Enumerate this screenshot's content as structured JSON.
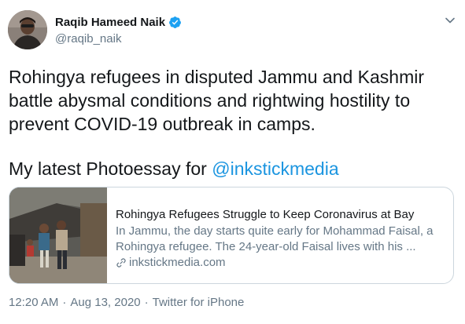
{
  "author": {
    "display_name": "Raqib Hameed Naik",
    "handle": "@raqib_naik",
    "verified": true
  },
  "tweet": {
    "body": "Rohingya refugees in disputed Jammu and Kashmir\nbattle abysmal conditions and rightwing hostility to\nprevent COVID-19 outbreak in camps.",
    "closing_text": "My latest Photoessay for ",
    "mention": "@inkstickmedia"
  },
  "card": {
    "title": "Rohingya Refugees Struggle to Keep Coronavirus at Bay",
    "description_line1": "In Jammu, the day starts quite early for Mohammad Faisal, a",
    "description_line2": "Rohingya refugee. The 24-year-old Faisal lives with his ...",
    "domain": "inkstickmedia.com"
  },
  "meta": {
    "time": "12:20 AM",
    "separator1": "·",
    "date": "Aug 13, 2020",
    "separator2": "·",
    "source": "Twitter for iPhone"
  },
  "icons": {
    "verified": "verified-badge-icon",
    "caret": "chevron-down-icon",
    "link": "link-icon"
  },
  "colors": {
    "link_blue": "#1b95e0",
    "secondary_text": "#657786",
    "border": "#ccd6dd"
  }
}
